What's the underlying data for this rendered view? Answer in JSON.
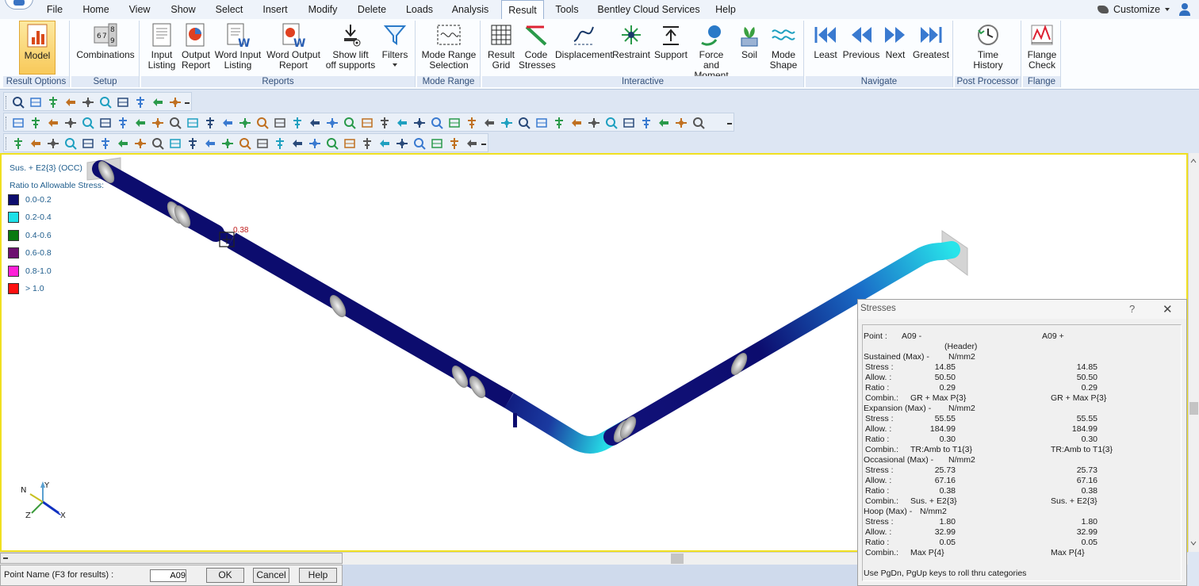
{
  "menu": {
    "items": [
      "File",
      "Home",
      "View",
      "Show",
      "Select",
      "Insert",
      "Modify",
      "Delete",
      "Loads",
      "Analysis",
      "Result",
      "Tools",
      "Bentley Cloud Services",
      "Help"
    ],
    "active": "Result",
    "customize": "Customize"
  },
  "ribbon": {
    "groups": {
      "result_options": "Result Options",
      "setup": "Setup",
      "reports": "Reports",
      "mode_range": "Mode Range",
      "interactive": "Interactive",
      "navigate": "Navigate",
      "post_processor": "Post Processor",
      "flange": "Flange"
    },
    "buttons": {
      "model": "Model",
      "combinations": "Combinations",
      "input_listing": [
        "Input",
        "Listing"
      ],
      "output_report": [
        "Output",
        "Report"
      ],
      "word_input_listing": [
        "Word Input",
        "Listing"
      ],
      "word_output_report": [
        "Word Output",
        "Report"
      ],
      "show_liftoff": [
        "Show lift",
        "off supports"
      ],
      "filters": "Filters",
      "mode_range_selection": [
        "Mode Range",
        "Selection"
      ],
      "result_grid": [
        "Result",
        "Grid"
      ],
      "code_stresses": [
        "Code",
        "Stresses"
      ],
      "displacement": "Displacement",
      "restraint": "Restraint",
      "support": "Support",
      "force_moment": [
        "Force and",
        "Moment"
      ],
      "soil": "Soil",
      "mode_shape": [
        "Mode",
        "Shape"
      ],
      "least": "Least",
      "previous": "Previous",
      "next": "Next",
      "greatest": "Greatest",
      "time_history": [
        "Time",
        "History"
      ],
      "flange_check": [
        "Flange",
        "Check"
      ]
    },
    "combinations_digits": [
      "6",
      "7",
      "8",
      "9"
    ]
  },
  "viewport": {
    "legend_title": "Sus. + E2{3} (OCC)",
    "legend_subtitle": "Ratio to Allowable Stress:",
    "legend": [
      {
        "label": "0.0-0.2",
        "color": "#0c0c6e"
      },
      {
        "label": "0.2-0.4",
        "color": "#1ee0e8"
      },
      {
        "label": "0.4-0.6",
        "color": "#0a7a10"
      },
      {
        "label": "0.6-0.8",
        "color": "#6d1070"
      },
      {
        "label": "0.8-1.0",
        "color": "#ff20d8"
      },
      {
        "label": "> 1.0",
        "color": "#ff1010"
      }
    ],
    "marker_value": "0.38",
    "axis": {
      "x": "X",
      "y": "Y",
      "z": "Z",
      "n": "N"
    }
  },
  "point_bar": {
    "label": "Point Name (F3 for results) :",
    "value": "A09",
    "ok": "OK",
    "cancel": "Cancel",
    "help": "Help"
  },
  "stresses": {
    "title": "Stresses",
    "help": "?",
    "point_label": "Point :",
    "point_minus": "A09   -",
    "point_plus": "A09   +",
    "header_note": "(Header)",
    "sections": [
      {
        "title": "Sustained (Max) -",
        "unit": "N/mm2",
        "stress": [
          "14.85",
          "14.85"
        ],
        "allow": [
          "50.50",
          "50.50"
        ],
        "ratio": [
          "0.29",
          "0.29"
        ],
        "combin": [
          "GR + Max P{3}",
          "GR + Max P{3}"
        ]
      },
      {
        "title": "Expansion (Max) -",
        "unit": "N/mm2",
        "stress": [
          "55.55",
          "55.55"
        ],
        "allow": [
          "184.99",
          "184.99"
        ],
        "ratio": [
          "0.30",
          "0.30"
        ],
        "combin": [
          "TR:Amb to T1{3}",
          "TR:Amb to T1{3}"
        ]
      },
      {
        "title": "Occasional (Max) -",
        "unit": "N/mm2",
        "stress": [
          "25.73",
          "25.73"
        ],
        "allow": [
          "67.16",
          "67.16"
        ],
        "ratio": [
          "0.38",
          "0.38"
        ],
        "combin": [
          "Sus. + E2{3}",
          "Sus. + E2{3}"
        ]
      },
      {
        "title": "Hoop (Max) -",
        "unit": "N/mm2",
        "stress": [
          "1.80",
          "1.80"
        ],
        "allow": [
          "32.99",
          "32.99"
        ],
        "ratio": [
          "0.05",
          "0.05"
        ],
        "combin": [
          "Max P{4}",
          "Max P{4}"
        ]
      }
    ],
    "row_labels": {
      "stress": "Stress :",
      "allow": "Allow. :",
      "ratio": "Ratio :",
      "combin": "Combin.:"
    },
    "footer": "Use PgDn, PgUp keys to roll thru categories"
  }
}
